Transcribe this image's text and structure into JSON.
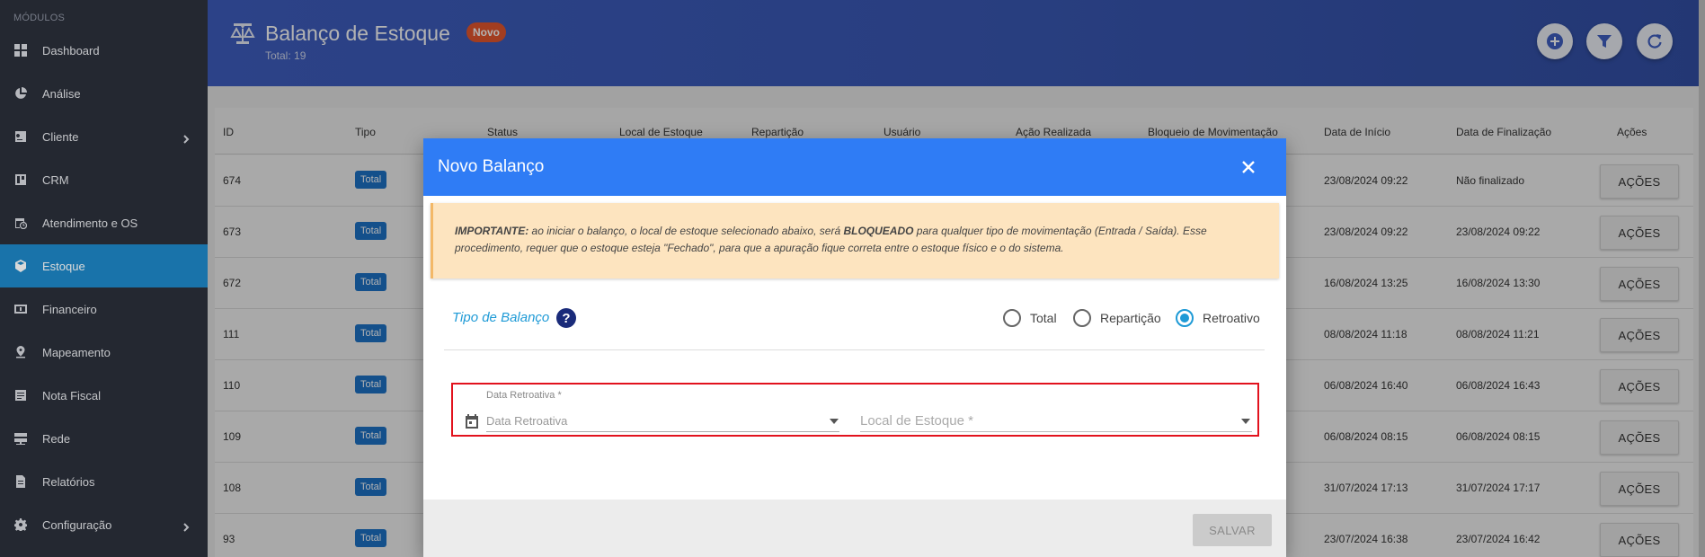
{
  "sidebar": {
    "section_label": "MÓDULOS",
    "items": [
      {
        "label": "Dashboard",
        "icon": "grid-icon"
      },
      {
        "label": "Análise",
        "icon": "pie-chart-icon"
      },
      {
        "label": "Cliente",
        "icon": "id-card-icon",
        "has_children": true
      },
      {
        "label": "CRM",
        "icon": "board-icon"
      },
      {
        "label": "Atendimento e OS",
        "icon": "calendar-clock-icon"
      },
      {
        "label": "Estoque",
        "icon": "box-icon",
        "active": true
      },
      {
        "label": "Financeiro",
        "icon": "money-icon"
      },
      {
        "label": "Mapeamento",
        "icon": "map-pin-icon"
      },
      {
        "label": "Nota Fiscal",
        "icon": "receipt-icon"
      },
      {
        "label": "Rede",
        "icon": "server-icon"
      },
      {
        "label": "Relatórios",
        "icon": "report-icon"
      },
      {
        "label": "Configuração",
        "icon": "gear-icon",
        "has_children": true
      }
    ]
  },
  "header": {
    "title": "Balanço de Estoque",
    "badge": "Novo",
    "subtitle": "Total: 19",
    "buttons": [
      "add-icon",
      "filter-icon",
      "refresh-icon"
    ]
  },
  "table": {
    "columns": [
      "ID",
      "Tipo",
      "Status",
      "Local de Estoque",
      "Repartição",
      "Usuário",
      "Ação Realizada",
      "Bloqueio de Movimentação",
      "Data de Início",
      "Data de Finalização",
      "Ações"
    ],
    "rows": [
      {
        "id": "674",
        "tipo": "Total",
        "inicio": "23/08/2024 09:22",
        "fim": "Não finalizado",
        "acao": "AÇÕES"
      },
      {
        "id": "673",
        "tipo": "Total",
        "inicio": "23/08/2024 09:22",
        "fim": "23/08/2024 09:22",
        "acao": "AÇÕES"
      },
      {
        "id": "672",
        "tipo": "Total",
        "inicio": "16/08/2024 13:25",
        "fim": "16/08/2024 13:30",
        "acao": "AÇÕES"
      },
      {
        "id": "111",
        "tipo": "Total",
        "inicio": "08/08/2024 11:18",
        "fim": "08/08/2024 11:21",
        "acao": "AÇÕES"
      },
      {
        "id": "110",
        "tipo": "Total",
        "inicio": "06/08/2024 16:40",
        "fim": "06/08/2024 16:43",
        "acao": "AÇÕES"
      },
      {
        "id": "109",
        "tipo": "Total",
        "inicio": "06/08/2024 08:15",
        "fim": "06/08/2024 08:15",
        "acao": "AÇÕES"
      },
      {
        "id": "108",
        "tipo": "Total",
        "inicio": "31/07/2024 17:13",
        "fim": "31/07/2024 17:17",
        "acao": "AÇÕES"
      },
      {
        "id": "93",
        "tipo": "Total",
        "inicio": "23/07/2024 16:38",
        "fim": "23/07/2024 16:42",
        "acao": "AÇÕES"
      }
    ]
  },
  "modal": {
    "title": "Novo Balanço",
    "warning": {
      "lead": "IMPORTANTE:",
      "part1": " ao iniciar o balanço, o local de estoque selecionado abaixo, será ",
      "bold": "BLOQUEADO",
      "part2": " para qualquer tipo de movimentação (Entrada / Saída). Esse procedimento, requer que o estoque esteja \"Fechado\", para que a apuração fique correta entre o estoque físico e o do sistema."
    },
    "type_label": "Tipo de Balanço",
    "help": "?",
    "radios": [
      {
        "label": "Total",
        "selected": false
      },
      {
        "label": "Repartição",
        "selected": false
      },
      {
        "label": "Retroativo",
        "selected": true
      }
    ],
    "date_field": {
      "label": "Data Retroativa *",
      "placeholder": "Data Retroativa"
    },
    "local_field": {
      "placeholder": "Local de Estoque *"
    },
    "save_label": "SALVAR"
  },
  "colors": {
    "accent": "#2f7cf5",
    "sidebar": "#2b2f3a",
    "active": "#1e88c8",
    "header": "#3f5fc3",
    "badge": "#e8582e",
    "highlight": "#e2121d"
  }
}
